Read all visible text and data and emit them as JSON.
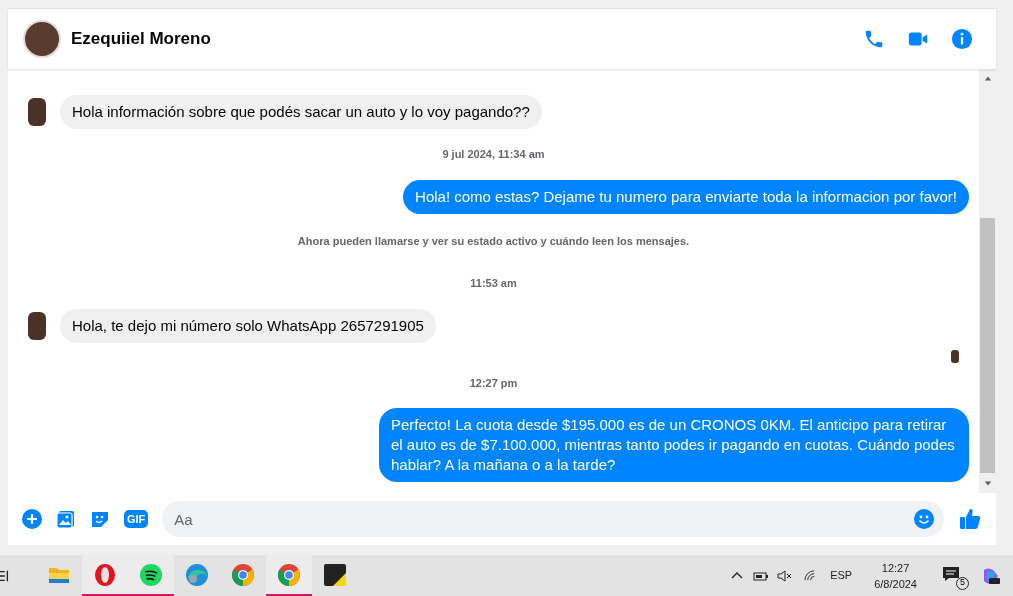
{
  "contact": {
    "name": "Ezequiiel Moreno"
  },
  "messages": [
    {
      "kind": "incoming",
      "text": "Hola información sobre que podés sacar un auto y lo voy pagando??"
    },
    {
      "kind": "time",
      "text": "9 jul 2024, 11:34 am"
    },
    {
      "kind": "outgoing",
      "text": "Hola! como estas? Dejame tu numero para enviarte toda la informacion por favor!"
    },
    {
      "kind": "notice",
      "text": "Ahora pueden llamarse y ver su estado activo y cuándo leen los mensajes."
    },
    {
      "kind": "time",
      "text": "11:53 am"
    },
    {
      "kind": "incoming",
      "text": "Hola, te dejo mi número solo WhatsApp 2657291905"
    },
    {
      "kind": "seen"
    },
    {
      "kind": "time",
      "text": "12:27 pm"
    },
    {
      "kind": "outgoing",
      "text": "Perfecto! La cuota desde $195.000 es de un CRONOS 0KM. El anticipo para retirar el auto es de $7.100.000, mientras tanto podes ir pagando en cuotas. Cuándo podes hablar? A la mañana o a la tarde?"
    }
  ],
  "composer": {
    "placeholder": "Aa",
    "gif_label": "GIF"
  },
  "taskbar": {
    "apps": [
      {
        "kind": "files",
        "active": false
      },
      {
        "kind": "opera",
        "active": true
      },
      {
        "kind": "spotify",
        "active": true
      },
      {
        "kind": "edge",
        "active": false
      },
      {
        "kind": "chrome",
        "active": false
      },
      {
        "kind": "chrome",
        "active": true
      },
      {
        "kind": "notes",
        "active": false
      }
    ],
    "language": "ESP",
    "time": "12:27",
    "date": "6/8/2024",
    "notification_count": "5"
  }
}
